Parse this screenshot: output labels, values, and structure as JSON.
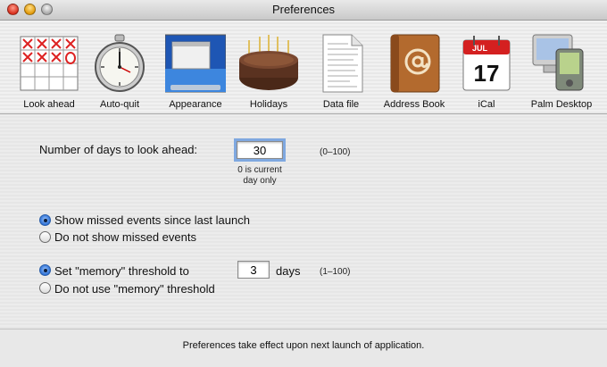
{
  "window": {
    "title": "Preferences"
  },
  "toolbar": {
    "items": [
      {
        "label": "Look ahead",
        "icon": "calendar-grid-icon"
      },
      {
        "label": "Auto-quit",
        "icon": "stopwatch-icon"
      },
      {
        "label": "Appearance",
        "icon": "desktop-screen-icon"
      },
      {
        "label": "Holidays",
        "icon": "birthday-cake-icon"
      },
      {
        "label": "Data file",
        "icon": "document-icon"
      },
      {
        "label": "Address Book",
        "icon": "address-book-icon"
      },
      {
        "label": "iCal",
        "icon": "ical-calendar-icon",
        "month": "JUL",
        "day": "17"
      },
      {
        "label": "Palm Desktop",
        "icon": "palm-device-icon"
      }
    ]
  },
  "look_ahead": {
    "label": "Number of days to look ahead:",
    "value": "30",
    "range": "(0–100)",
    "hint_line1": "0 is current",
    "hint_line2": "day only"
  },
  "missed_events": {
    "options": [
      {
        "label": "Show missed events since last launch",
        "selected": true
      },
      {
        "label": "Do not show missed events",
        "selected": false
      }
    ]
  },
  "memory": {
    "options": [
      {
        "label": "Set \"memory\" threshold to",
        "selected": true
      },
      {
        "label": "Do not use \"memory\" threshold",
        "selected": false
      }
    ],
    "value": "3",
    "unit": "days",
    "range": "(1–100)"
  },
  "footer": {
    "note": "Preferences take effect upon next launch of application."
  },
  "colors": {
    "accent": "#2c6fd4",
    "focus_ring": "#7fa8e0"
  }
}
